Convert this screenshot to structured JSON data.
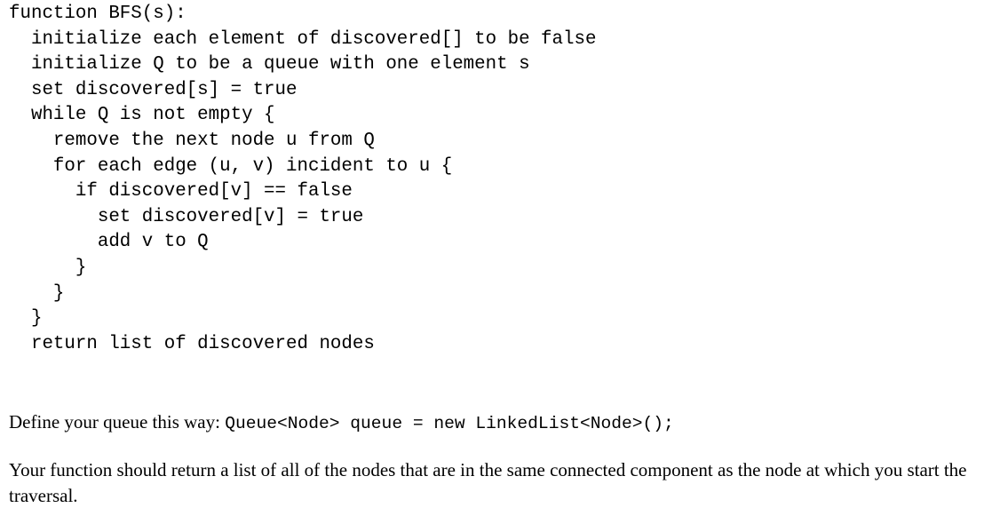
{
  "document": {
    "code_block": {
      "name": "bfs-pseudocode",
      "lines": [
        "function BFS(s):",
        "  initialize each element of discovered[] to be false",
        "  initialize Q to be a queue with one element s",
        "  set discovered[s] = true",
        "  while Q is not empty {",
        "    remove the next node u from Q",
        "    for each edge (u, v) incident to u {",
        "      if discovered[v] == false",
        "        set discovered[v] = true",
        "        add v to Q",
        "      }",
        "    }",
        "  }",
        "  return list of discovered nodes"
      ]
    },
    "paragraphs": [
      {
        "name": "define-queue-instruction",
        "lead_text": "Define your queue this way: ",
        "code_text": "Queue<Node> queue = new LinkedList<Node>();",
        "trail_text": ""
      },
      {
        "name": "return-value-instruction",
        "text": "Your function should return a list of all of the nodes that are in the same connected component as the node at which you start the traversal."
      }
    ]
  },
  "colors": {
    "background": "#ffffff",
    "text": "#000000"
  }
}
